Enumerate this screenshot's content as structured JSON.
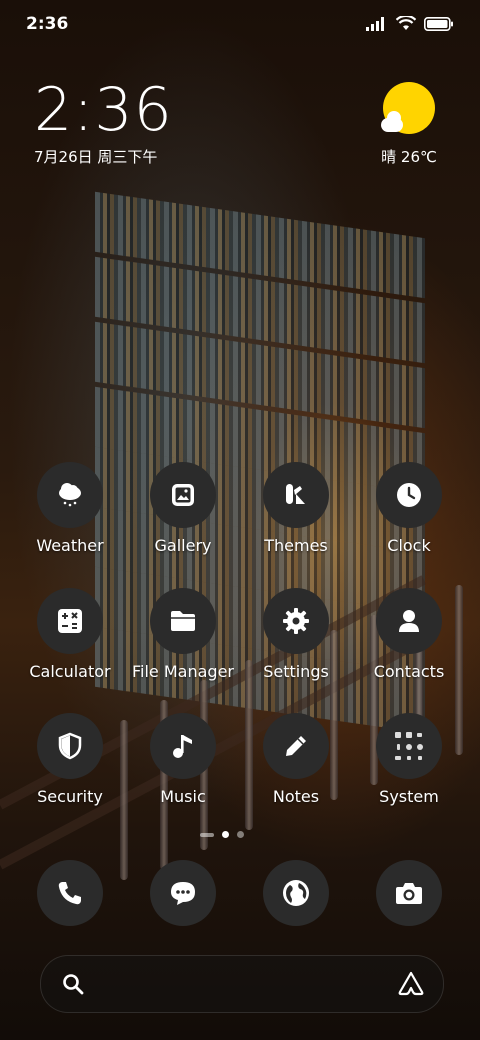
{
  "status_bar": {
    "time": "2:36"
  },
  "clock_widget": {
    "time": "2:36",
    "date": "7月26日 周三下午"
  },
  "weather_widget": {
    "temperature": "晴 26℃"
  },
  "apps": [
    {
      "label": "Weather",
      "icon": "weather-icon"
    },
    {
      "label": "Gallery",
      "icon": "gallery-icon"
    },
    {
      "label": "Themes",
      "icon": "themes-icon"
    },
    {
      "label": "Clock",
      "icon": "clock-icon"
    },
    {
      "label": "Calculator",
      "icon": "calculator-icon"
    },
    {
      "label": "File Manager",
      "icon": "folder-icon"
    },
    {
      "label": "Settings",
      "icon": "gear-icon"
    },
    {
      "label": "Contacts",
      "icon": "contacts-icon"
    },
    {
      "label": "Security",
      "icon": "shield-icon"
    },
    {
      "label": "Music",
      "icon": "music-note-icon"
    },
    {
      "label": "Notes",
      "icon": "pencil-icon"
    },
    {
      "label": "System",
      "icon": "folder-grid-icon"
    }
  ],
  "dock": [
    {
      "icon": "phone-icon"
    },
    {
      "icon": "message-icon"
    },
    {
      "icon": "browser-globe-icon"
    },
    {
      "icon": "camera-icon"
    }
  ],
  "page_indicator": {
    "current": 1,
    "total": 2
  },
  "colors": {
    "icon_bg": "#2b2b2b",
    "sun": "#ffd400"
  }
}
